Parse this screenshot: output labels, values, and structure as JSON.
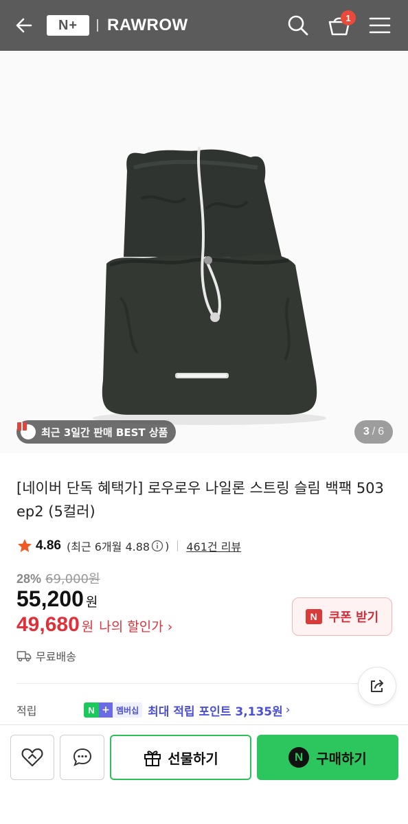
{
  "header": {
    "back_icon": "arrow-left-icon",
    "npay_logo": "N+",
    "brand": "RAWROW",
    "search_icon": "search-icon",
    "cart_icon": "basket-icon",
    "cart_count": "1",
    "menu_icon": "hamburger-icon",
    "background": "#5b5b5b"
  },
  "gallery": {
    "badge_label": "최근 3일간 판매 BEST 상품",
    "badge_icon": "gift-box-icon",
    "current": "3",
    "separator": "/",
    "total": "6"
  },
  "product": {
    "title": "[네이버 단독 혜택가] 로우로우 나일론 스트링 슬림 백팩 503 ep2 (5컬러)",
    "rating": "4.86",
    "rating_recent": "(최근 6개월 4.88",
    "rating_close": ")",
    "review_link": "461건 리뷰",
    "discount_rate": "28%",
    "original_price": "69,000원",
    "price": "55,200",
    "price_unit": "원",
    "my_price": "49,680",
    "my_price_unit": "원",
    "my_price_label": "나의 할인가",
    "my_price_chevron": "›",
    "coupon_icon_text": "N",
    "coupon_label": "쿠폰 받기",
    "shipping": "무료배송",
    "points_label": "적립",
    "membership_n": "N",
    "membership_plus": "+",
    "membership_text": "멤버십",
    "points_text": "최대 적립 포인트 3,135원",
    "points_chevron": "›"
  },
  "bottom_bar": {
    "like_icon": "heart-icon",
    "chat_icon": "chat-bubble-icon",
    "gift_icon": "gift-icon",
    "gift_label": "선물하기",
    "buy_icon_text": "N",
    "buy_label": "구매하기"
  },
  "colors": {
    "accent_red": "#e0313b",
    "npay_green": "#2dc55d",
    "points_blue": "#4a4fd3",
    "star_orange": "#f05a24"
  }
}
